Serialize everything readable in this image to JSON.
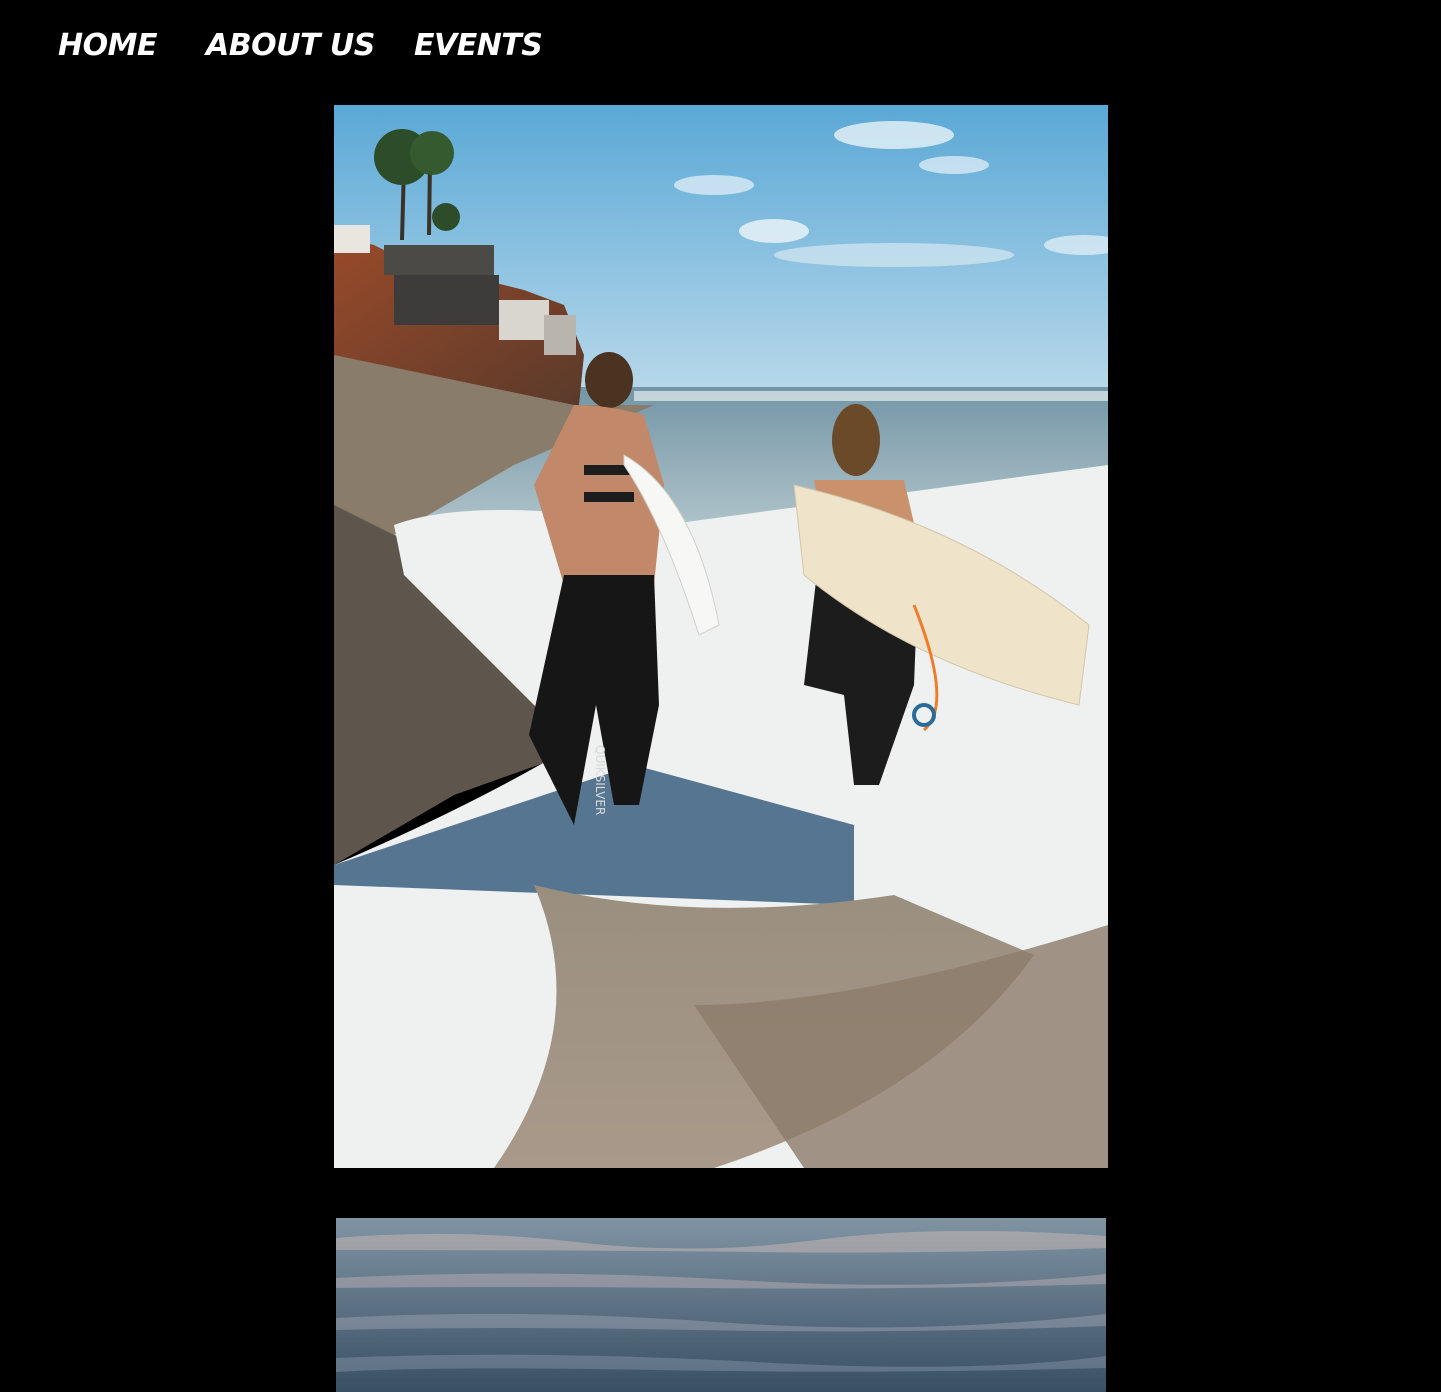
{
  "nav": {
    "items": [
      {
        "label": "HOME"
      },
      {
        "label": "ABOUT US"
      },
      {
        "label": "EVENTS"
      }
    ]
  },
  "gallery": {
    "images": [
      {
        "name": "surfers-walking-photo",
        "wetsuit_text": "QUIKSILVER"
      },
      {
        "name": "ocean-water-photo"
      }
    ]
  },
  "colors": {
    "background": "#000000",
    "nav_text": "#ffffff",
    "sky": "#6fb2d8",
    "sea": "#5a7f92",
    "foam": "#f1f3f2",
    "sand": "#8d7e6c"
  }
}
